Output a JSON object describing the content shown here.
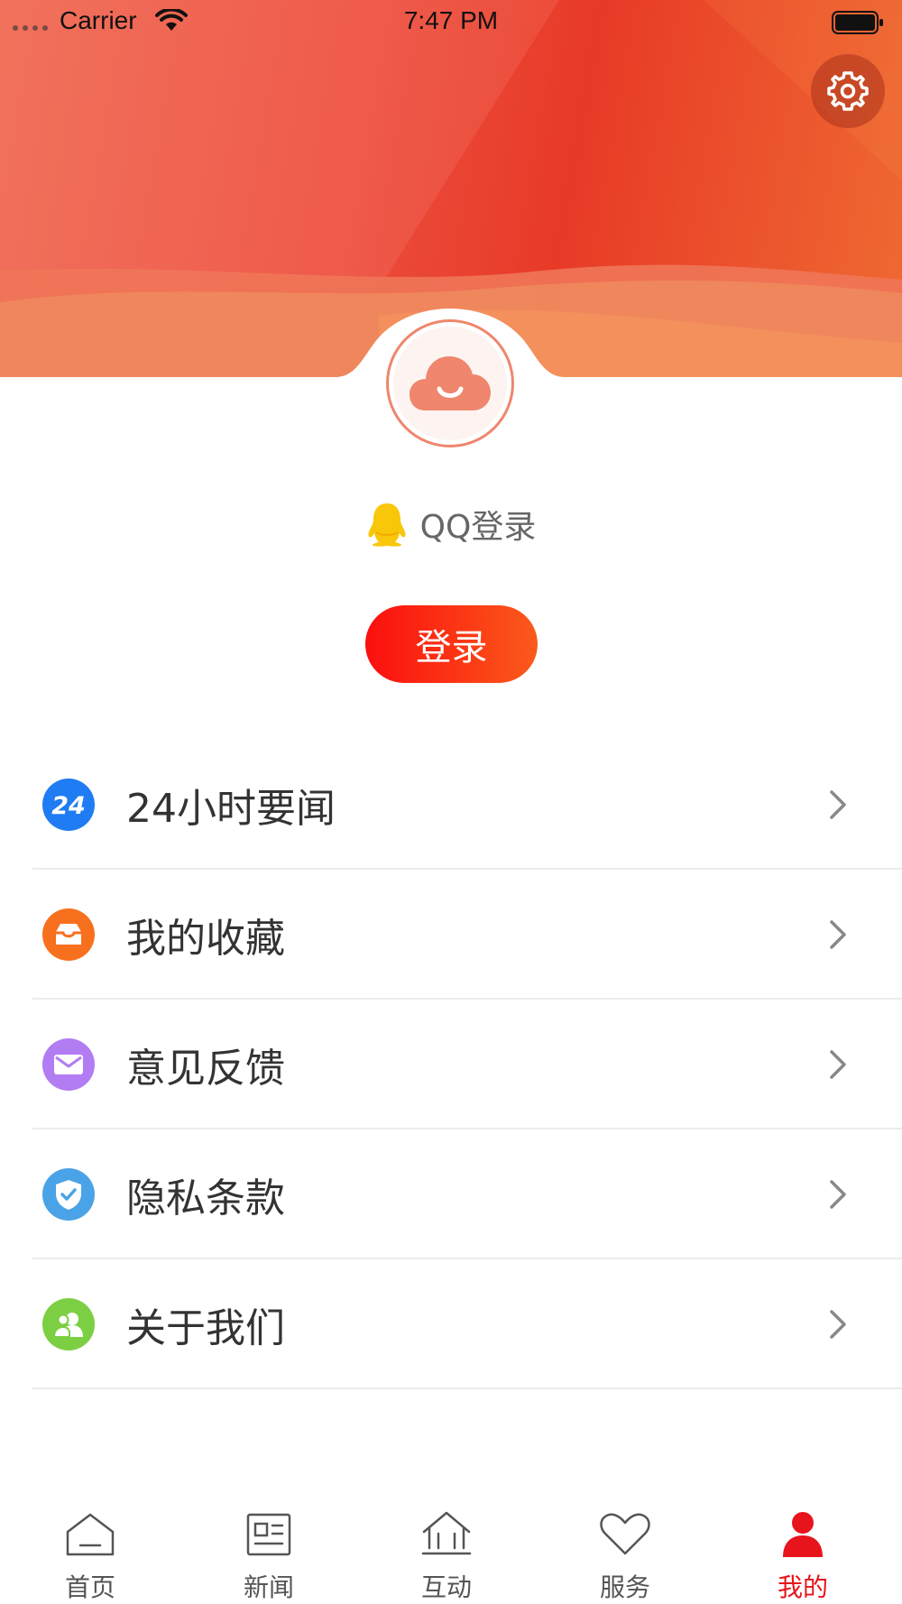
{
  "status_bar": {
    "carrier": "Carrier",
    "time": "7:47 PM"
  },
  "header": {
    "qq_login_label": "QQ登录",
    "login_button": "登录"
  },
  "menu": [
    {
      "label": "24小时要闻",
      "icon": "24h-news-icon",
      "color": "#1f7cf2"
    },
    {
      "label": "我的收藏",
      "icon": "inbox-icon",
      "color": "#f7701e"
    },
    {
      "label": "意见反馈",
      "icon": "mail-icon",
      "color": "#b27cf3"
    },
    {
      "label": "隐私条款",
      "icon": "shield-check-icon",
      "color": "#4aa3e6"
    },
    {
      "label": "关于我们",
      "icon": "users-icon",
      "color": "#7ccf42"
    }
  ],
  "tabs": [
    {
      "label": "首页",
      "icon": "home-icon"
    },
    {
      "label": "新闻",
      "icon": "newspaper-icon"
    },
    {
      "label": "互动",
      "icon": "interact-house-icon"
    },
    {
      "label": "服务",
      "icon": "heart-icon"
    },
    {
      "label": "我的",
      "icon": "person-icon",
      "active": true
    }
  ],
  "colors": {
    "accent": "#e8141b",
    "header_red": "#e83a27"
  }
}
